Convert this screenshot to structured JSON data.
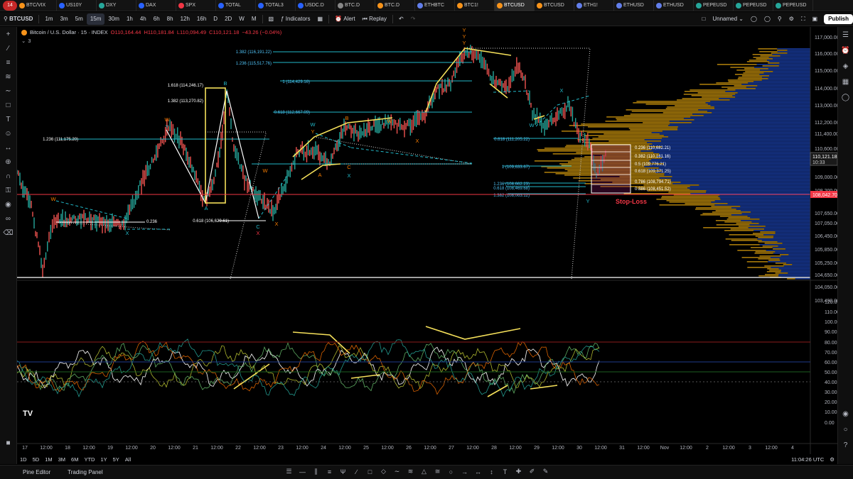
{
  "browser": {
    "notification_count": "14",
    "tabs": [
      {
        "label": "BTC/VIX",
        "color": "#f7931a"
      },
      {
        "label": "US10Y",
        "color": "#2962ff"
      },
      {
        "label": "DXY",
        "color": "#26a69a"
      },
      {
        "label": "DAX",
        "color": "#2962ff"
      },
      {
        "label": "SPX",
        "color": "#f23645"
      },
      {
        "label": "TOTAL",
        "color": "#2962ff"
      },
      {
        "label": "TOTAL3",
        "color": "#2962ff"
      },
      {
        "label": "USDC.D",
        "color": "#2962ff"
      },
      {
        "label": "BTC.D",
        "color": "#888888"
      },
      {
        "label": "BTC.D",
        "color": "#f7931a"
      },
      {
        "label": "ETHBTC",
        "color": "#627eea"
      },
      {
        "label": "BTC1!",
        "color": "#f7931a"
      },
      {
        "label": "BTCUSD",
        "color": "#f7931a",
        "active": true
      },
      {
        "label": "BTCUSD",
        "color": "#f7931a"
      },
      {
        "label": "ETH1!",
        "color": "#627eea"
      },
      {
        "label": "ETHUSD",
        "color": "#627eea"
      },
      {
        "label": "ETHUSD",
        "color": "#627eea"
      },
      {
        "label": "PEPEUSD",
        "color": "#26a69a"
      },
      {
        "label": "PEPEUSD",
        "color": "#26a69a"
      },
      {
        "label": "PEPEUSD",
        "color": "#26a69a"
      }
    ]
  },
  "toolbar": {
    "symbol": "BTCUSD",
    "intervals": [
      "1m",
      "3m",
      "5m",
      "15m",
      "30m",
      "1h",
      "4h",
      "6h",
      "8h",
      "12h",
      "16h",
      "D",
      "2D",
      "W",
      "M"
    ],
    "active_interval": "15m",
    "indicators_label": "Indicators",
    "alert_label": "Alert",
    "replay_label": "Replay",
    "layout_name": "Unnamed",
    "publish_label": "Publish"
  },
  "legend": {
    "title": "Bitcoin / U.S. Dollar · 15 · INDEX",
    "open": "O110,164.44",
    "high": "H110,181.84",
    "low": "L110,094.49",
    "close": "C110,121.18",
    "change": "−43.26 (−0.04%)",
    "indicator_count": "3"
  },
  "price_axis": {
    "ticks": [
      "117,000.00",
      "116,000.00",
      "115,000.00",
      "114,000.00",
      "113,000.00",
      "112,200.00",
      "111,400.00",
      "110,600.00",
      "109,800.00",
      "109,000.00",
      "108,200.00",
      "107,650.00",
      "107,050.00",
      "106,450.00",
      "105,850.00",
      "105,250.00",
      "104,650.00",
      "104,050.00",
      "103,490.00"
    ],
    "current_price": "110,121.18",
    "countdown": "10:33",
    "stop_loss_price": "108,042.70"
  },
  "osc_axis": {
    "ticks": [
      "120.00",
      "110.00",
      "100.00",
      "90.00",
      "80.00",
      "70.00",
      "60.00",
      "50.00",
      "40.00",
      "30.00",
      "20.00",
      "10.00",
      "0.00"
    ]
  },
  "time_axis": {
    "labels": [
      "17",
      "12:00",
      "18",
      "12:00",
      "19",
      "12:00",
      "20",
      "12:00",
      "21",
      "12:00",
      "22",
      "12:00",
      "23",
      "12:00",
      "24",
      "12:00",
      "25",
      "12:00",
      "26",
      "12:00",
      "27",
      "12:00",
      "28",
      "12:00",
      "29",
      "12:00",
      "30",
      "12:00",
      "31",
      "12:00",
      "Nov",
      "12:00",
      "2",
      "12:00",
      "3",
      "12:00",
      "4"
    ]
  },
  "fib_labels": [
    {
      "text": "1.382 (116,191.22)"
    },
    {
      "text": "1.236 (115,517.76)"
    },
    {
      "text": "1 (114,429.16)"
    },
    {
      "text": "0.618 (112,667.09)"
    },
    {
      "text": "1.618 (114,246.17)"
    },
    {
      "text": "1.382 (113,270.82)"
    },
    {
      "text": "1.236 (111,175.20)"
    },
    {
      "text": "0.618 (106,629.61)"
    },
    {
      "text": "0.236"
    },
    {
      "text": "0.618 (111,205.22)"
    },
    {
      "text": "1 (109,633.67)"
    },
    {
      "text": "1.236 (108,662.23)"
    },
    {
      "text": "0.618 (108,469.68)"
    },
    {
      "text": "1.382 (108,063.12)"
    },
    {
      "text": "0.236 (110,682.21)"
    },
    {
      "text": "0.382 (110,181.16)"
    },
    {
      "text": "0.5 (109,776.21)"
    },
    {
      "text": "0.618 (109,371.25)"
    },
    {
      "text": "0.786 (108,794.71)"
    },
    {
      "text": "0.886 (108,451.52)"
    }
  ],
  "wave_labels": [
    {
      "text": "W"
    },
    {
      "text": "X"
    },
    {
      "text": "W"
    },
    {
      "text": "Y"
    },
    {
      "text": "A"
    },
    {
      "text": "B"
    },
    {
      "text": "C"
    },
    {
      "text": "X"
    },
    {
      "text": "W"
    },
    {
      "text": "X"
    },
    {
      "text": "W"
    },
    {
      "text": "Y"
    },
    {
      "text": "A"
    },
    {
      "text": "B"
    },
    {
      "text": "C"
    },
    {
      "text": "X"
    },
    {
      "text": "W"
    },
    {
      "text": "X"
    },
    {
      "text": "Y"
    },
    {
      "text": "Y"
    },
    {
      "text": "Y"
    },
    {
      "text": "W"
    },
    {
      "text": "X"
    },
    {
      "text": "Y"
    }
  ],
  "stop_loss_text": "Stop-Loss",
  "bottom": {
    "ranges": [
      "1D",
      "5D",
      "1M",
      "3M",
      "6M",
      "YTD",
      "1Y",
      "5Y",
      "All"
    ],
    "clock": "11:04:26 UTC"
  },
  "footer": {
    "pine_editor": "Pine Editor",
    "trading_panel": "Trading Panel"
  },
  "colors": {
    "fib_line": "#22b8c8",
    "fib_text": "#4fc3f7",
    "wave_yellow": "#f5e05a",
    "wave_orange": "#f57c00",
    "stop_loss": "#f23645",
    "volume_profile_blue": "#1a3fa8",
    "volume_profile_gold": "#b8860b"
  }
}
